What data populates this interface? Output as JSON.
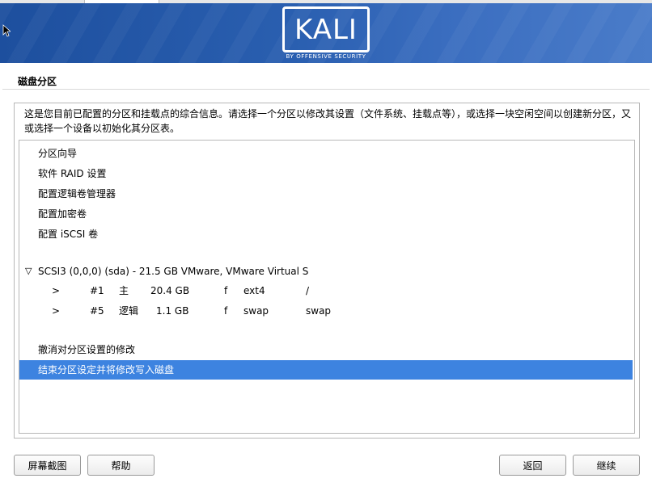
{
  "header": {
    "logo_text": "KALI",
    "logo_subtitle": "BY OFFENSIVE SECURITY"
  },
  "page": {
    "title": "磁盘分区",
    "description_line1": "这是您目前已配置的分区和挂载点的综合信息。请选择一个分区以修改其设置（文件系统、挂载点等），或选择一块空闲空间以创建新分区，又",
    "description_line2": "或选择一个设备以初始化其分区表。"
  },
  "menu_items": {
    "guided": "分区向导",
    "raid": "软件 RAID 设置",
    "lvm": "配置逻辑卷管理器",
    "crypto": "配置加密卷",
    "iscsi": "配置 iSCSI 卷"
  },
  "disk": {
    "label": "SCSI3 (0,0,0) (sda) - 21.5 GB VMware, VMware Virtual S",
    "expand_glyph": "▽",
    "partitions": [
      {
        "arrow": ">",
        "number": "#1",
        "type": "主",
        "size": "20.4 GB",
        "flag": "f",
        "fs": "ext4",
        "mount": "/"
      },
      {
        "arrow": ">",
        "number": "#5",
        "type": "逻辑",
        "size": "1.1 GB",
        "flag": "f",
        "fs": "swap",
        "mount": "swap"
      }
    ]
  },
  "actions": {
    "undo": "撤消对分区设置的修改",
    "finish": "结束分区设定并将修改写入磁盘"
  },
  "buttons": {
    "screenshot": "屏幕截图",
    "help": "帮助",
    "back": "返回",
    "continue": "继续"
  },
  "colors": {
    "banner": "#2a5fb0",
    "selection": "#3d83e0"
  }
}
